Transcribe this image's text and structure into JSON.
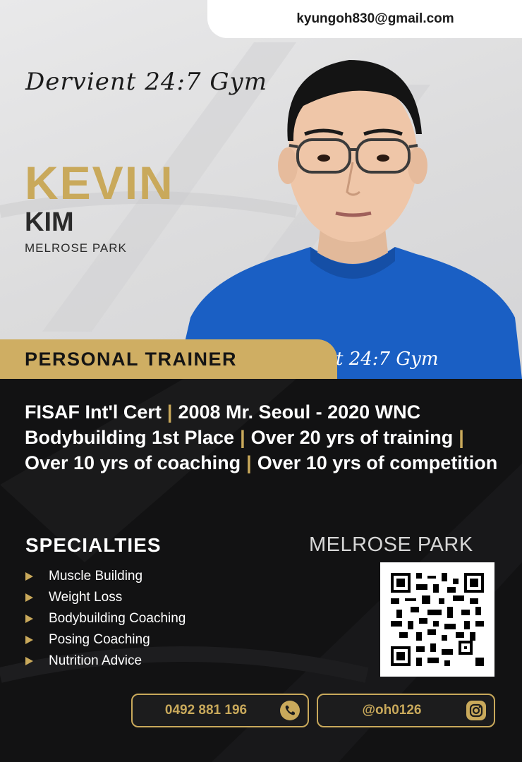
{
  "header": {
    "email": "kyungoh830@gmail.com"
  },
  "brand": {
    "signature": "Dervient 24:7 Gym",
    "shirt_signature": "t 24:7 Gym"
  },
  "trainer": {
    "first_name": "KEVIN",
    "last_name": "KIM",
    "location": "MELROSE PARK",
    "title": "PERSONAL TRAINER"
  },
  "credentials": {
    "lines": [
      [
        "FISAF Int'l Cert",
        "2008 Mr. Seoul - 2020 WNC"
      ],
      [
        "Bodybuilding 1st Place",
        "Over 20 yrs of training",
        ""
      ],
      [
        "Over 10 yrs of coaching",
        "Over 10 yrs of competition"
      ]
    ],
    "separator": "|"
  },
  "specialties": {
    "heading": "SPECIALTIES",
    "items": [
      "Muscle Building",
      "Weight Loss",
      "Bodybuilding Coaching",
      "Posing Coaching",
      "Nutrition Advice"
    ]
  },
  "gym_location": "MELROSE PARK",
  "contact": {
    "phone": "0492 881 196",
    "instagram": "@oh0126"
  },
  "colors": {
    "gold": "#c9a95b",
    "dark": "#121213",
    "shirt_blue": "#1a5fc4"
  },
  "icons": [
    "phone-icon",
    "instagram-icon",
    "qr-code",
    "arrow-icon"
  ]
}
